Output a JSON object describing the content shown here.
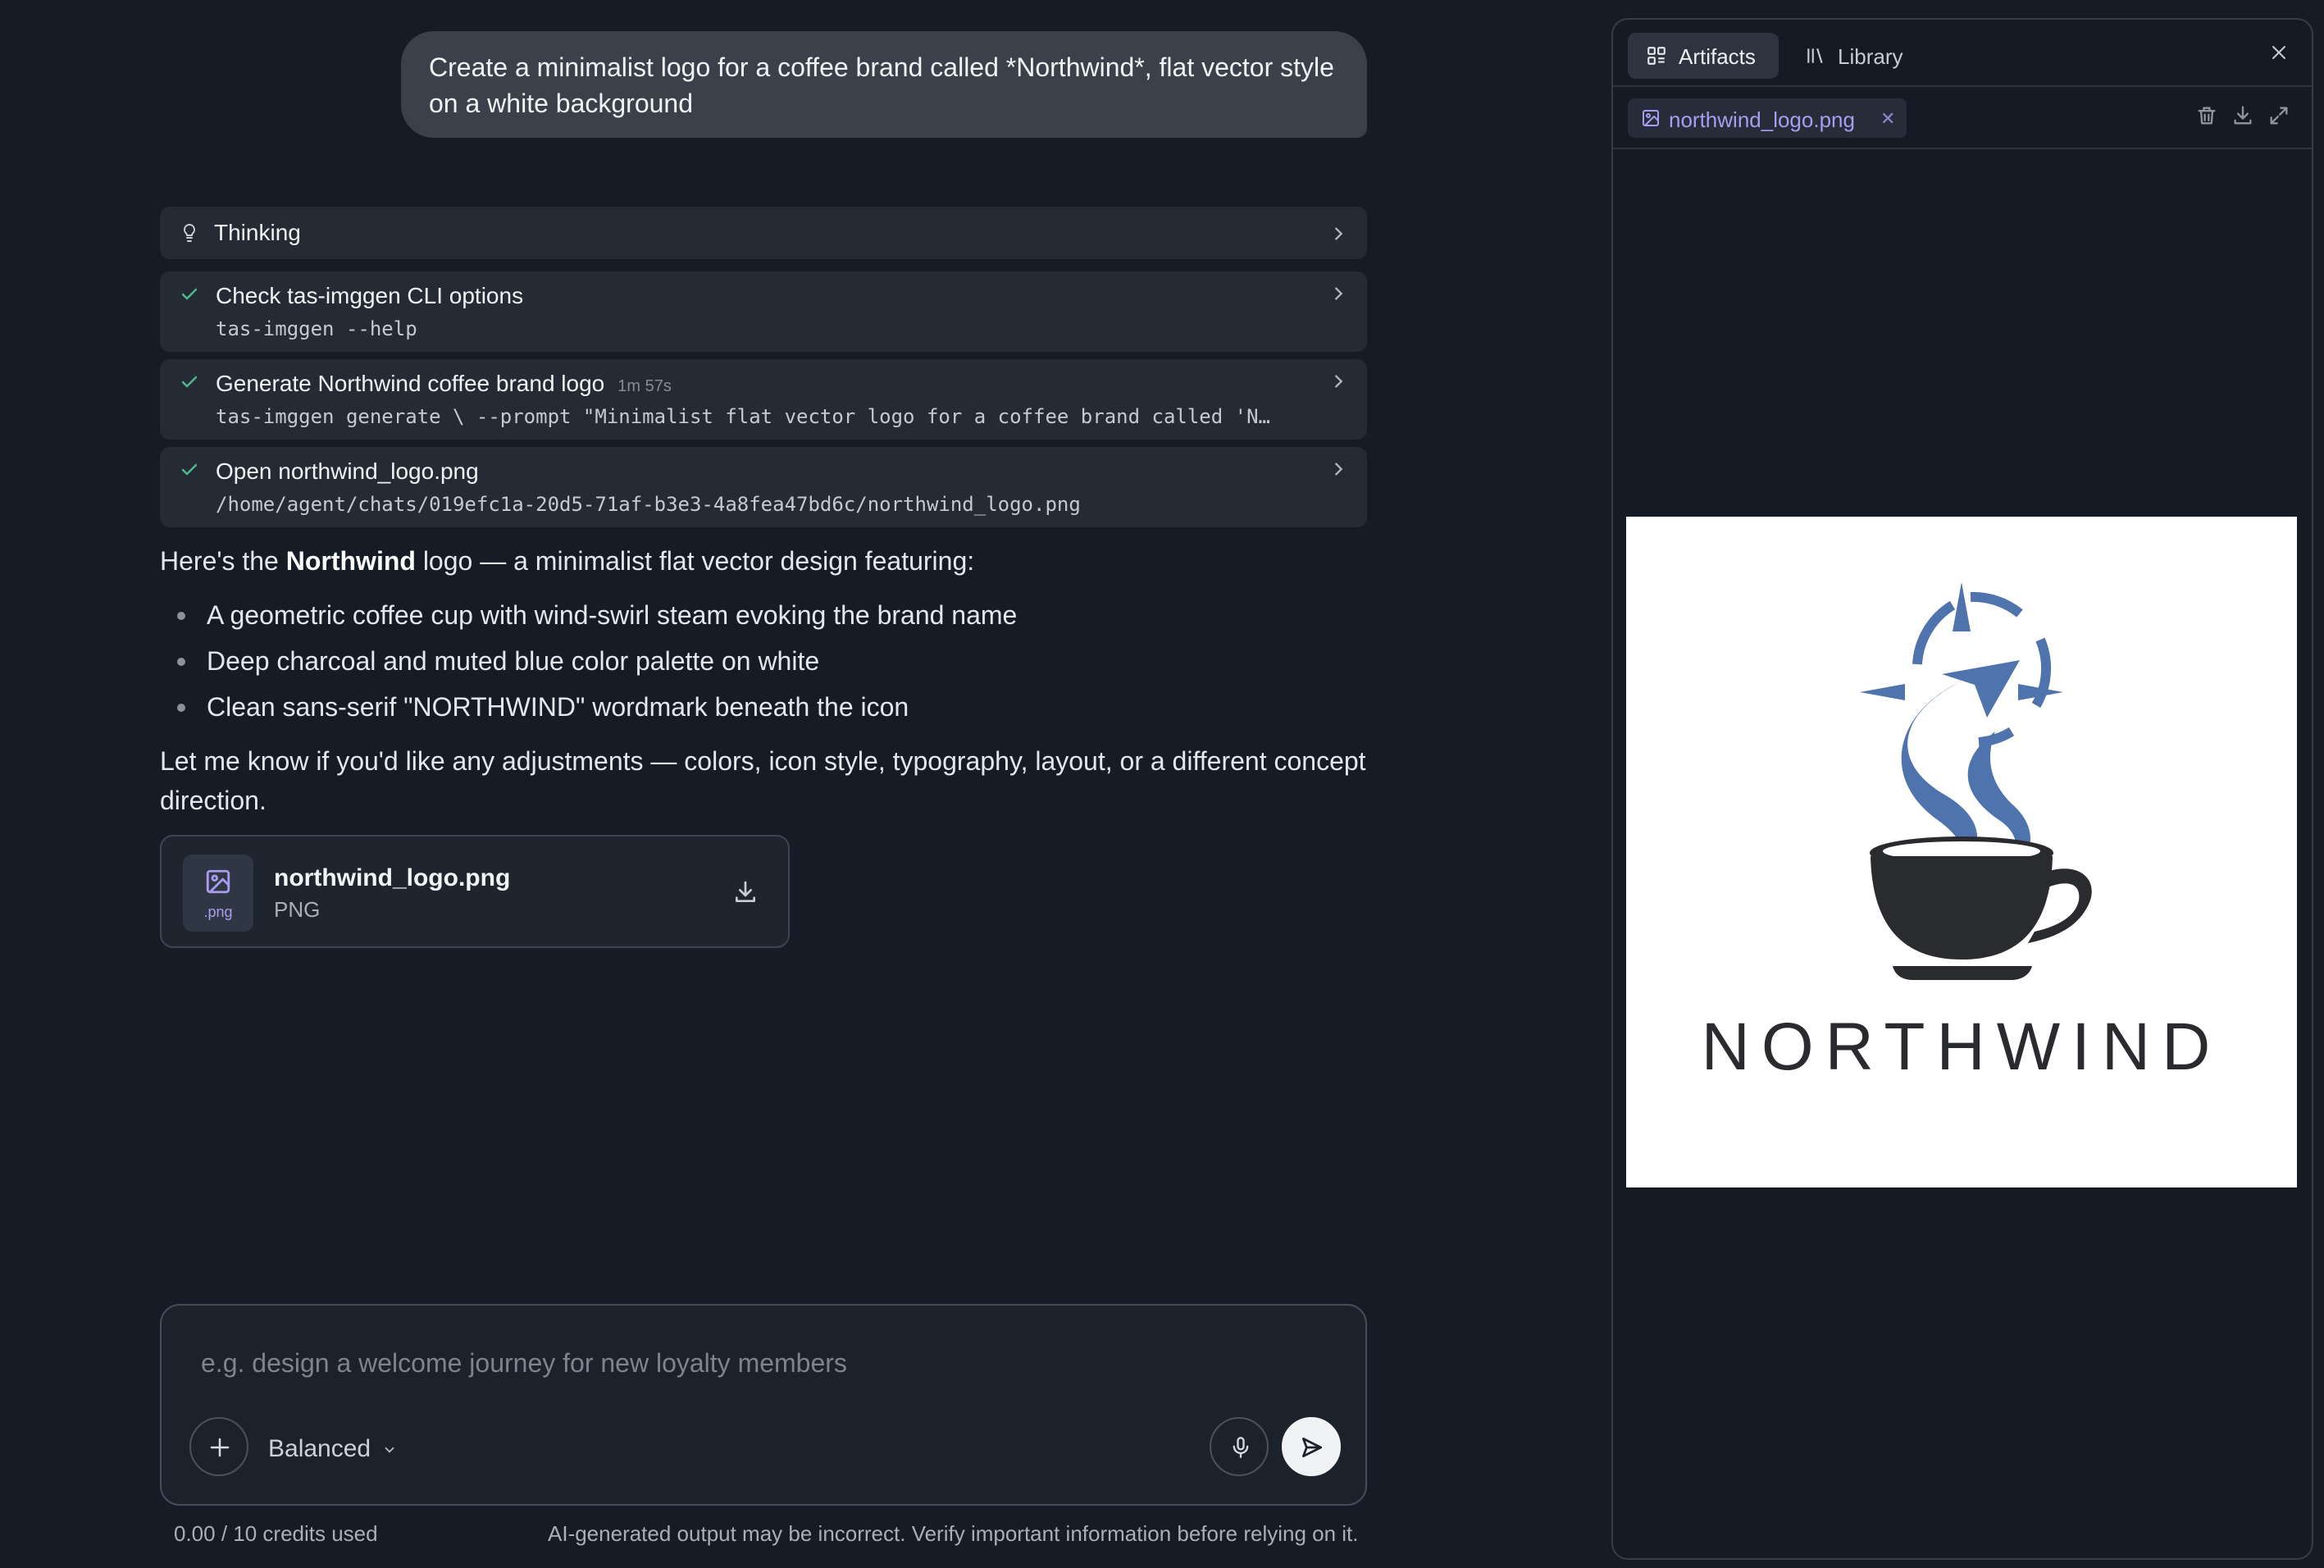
{
  "user_message": {
    "line1": "Create a minimalist logo for a coffee brand called *Northwind*, flat vector style",
    "line2": "on a white background"
  },
  "thinking": {
    "label": "Thinking"
  },
  "steps": [
    {
      "title": "Check tas-imggen CLI options",
      "command": "tas-imggen --help",
      "duration": ""
    },
    {
      "title": "Generate Northwind coffee brand logo",
      "command": "tas-imggen generate \\ --prompt \"Minimalist flat vector logo for a coffee brand called 'N…",
      "duration": "1m 57s"
    },
    {
      "title": "Open northwind_logo.png",
      "command": "/home/agent/chats/019efc1a-20d5-71af-b3e3-4a8fea47bd6c/northwind_logo.png",
      "duration": ""
    }
  ],
  "answer": {
    "intro_pre": "Here's the ",
    "intro_bold": "Northwind",
    "intro_post": " logo — a minimalist flat vector design featuring:",
    "bullets": [
      "A geometric coffee cup with wind-swirl steam evoking the brand name",
      "Deep charcoal and muted blue color palette on white",
      "Clean sans-serif \"NORTHWIND\" wordmark beneath the icon"
    ],
    "closing_line1": "Let me know if you'd like any adjustments — colors, icon style, typography, layout, or a different concept",
    "closing_line2": "direction."
  },
  "attachment": {
    "name": "northwind_logo.png",
    "type": "PNG",
    "thumb_ext": ".png"
  },
  "composer": {
    "placeholder": "e.g. design a welcome journey for new loyalty members",
    "mode": "Balanced"
  },
  "footer": {
    "credits": "0.00 / 10 credits used",
    "disclaimer": "AI-generated output may be incorrect. Verify important information before relying on it."
  },
  "panel": {
    "tabs": [
      {
        "label": "Artifacts"
      },
      {
        "label": "Library"
      }
    ],
    "active_file": "northwind_logo.png",
    "logo_wordmark": "NORTHWIND"
  },
  "colors": {
    "background": "#161c26",
    "accent_purple": "#a99cf0",
    "success_green": "#4fb88a",
    "logo_blue": "#4f73ad",
    "logo_charcoal": "#2a2b2e"
  }
}
